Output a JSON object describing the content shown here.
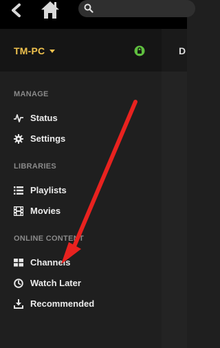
{
  "header": {
    "server_name": "TM-PC",
    "right_pane_title_partial": "D"
  },
  "sidebar": {
    "sections": [
      {
        "title": "MANAGE",
        "items": [
          {
            "label": "Status",
            "icon": "activity-icon"
          },
          {
            "label": "Settings",
            "icon": "gear-icon"
          }
        ]
      },
      {
        "title": "LIBRARIES",
        "items": [
          {
            "label": "Playlists",
            "icon": "list-icon"
          },
          {
            "label": "Movies",
            "icon": "film-icon"
          }
        ]
      },
      {
        "title": "ONLINE CONTENT",
        "items": [
          {
            "label": "Channels",
            "icon": "grid-icon"
          },
          {
            "label": "Watch Later",
            "icon": "clock-icon"
          },
          {
            "label": "Recommended",
            "icon": "download-icon"
          }
        ]
      }
    ]
  },
  "colors": {
    "server_accent": "#f0c24e",
    "lock_green": "#5fbf3f",
    "annotation_arrow": "#e8221f"
  }
}
